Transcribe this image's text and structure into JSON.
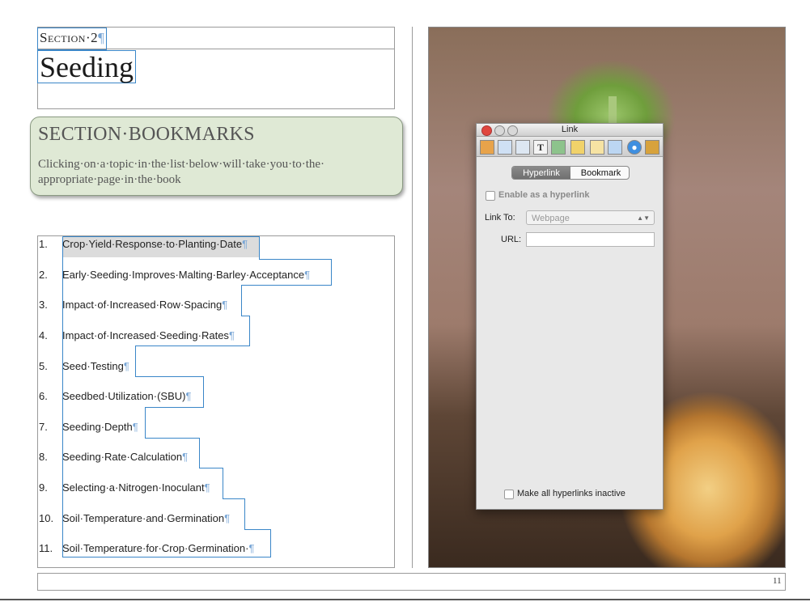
{
  "section": {
    "label": "Section·2",
    "title": "Seeding"
  },
  "bookmarks": {
    "title": "SECTION·BOOKMARKS",
    "description": "Clicking·on·a·topic·in·the·list·below·will·take·you·to·the· appropriate·page·in·the·book"
  },
  "pilcrow": "¶",
  "list": [
    {
      "num": "1.",
      "text": "Crop·Yield·Response·to·Planting·Date"
    },
    {
      "num": "2.",
      "text": "Early·Seeding·Improves·Malting·Barley·Acceptance"
    },
    {
      "num": "3.",
      "text": "Impact·of·Increased·Row·Spacing"
    },
    {
      "num": "4.",
      "text": "Impact·of·Increased·Seeding·Rates"
    },
    {
      "num": "5.",
      "text": "Seed·Testing"
    },
    {
      "num": "6.",
      "text": "Seedbed·Utilization·(SBU)"
    },
    {
      "num": "7.",
      "text": "Seeding·Depth"
    },
    {
      "num": "8.",
      "text": "Seeding·Rate·Calculation"
    },
    {
      "num": "9.",
      "text": "Selecting·a·Nitrogen·Inoculant"
    },
    {
      "num": "10.",
      "text": "Soil·Temperature·and·Germination"
    },
    {
      "num": "11.",
      "text": "Soil·Temperature·for·Crop·Germination·"
    }
  ],
  "page_number": "11",
  "inspector": {
    "title": "Link",
    "toolbar_icons": [
      "document-icon",
      "layout-icon",
      "wrap-icon",
      "text-icon",
      "graphic-icon",
      "metrics-icon",
      "table-icon",
      "chart-icon",
      "link-icon",
      "quicktime-icon"
    ],
    "tabs": {
      "hyperlink": "Hyperlink",
      "bookmark": "Bookmark"
    },
    "enable_label": "Enable as a hyperlink",
    "link_to_label": "Link To:",
    "link_to_value": "Webpage",
    "url_label": "URL:",
    "url_value": "",
    "inactive_label": "Make all hyperlinks inactive"
  }
}
